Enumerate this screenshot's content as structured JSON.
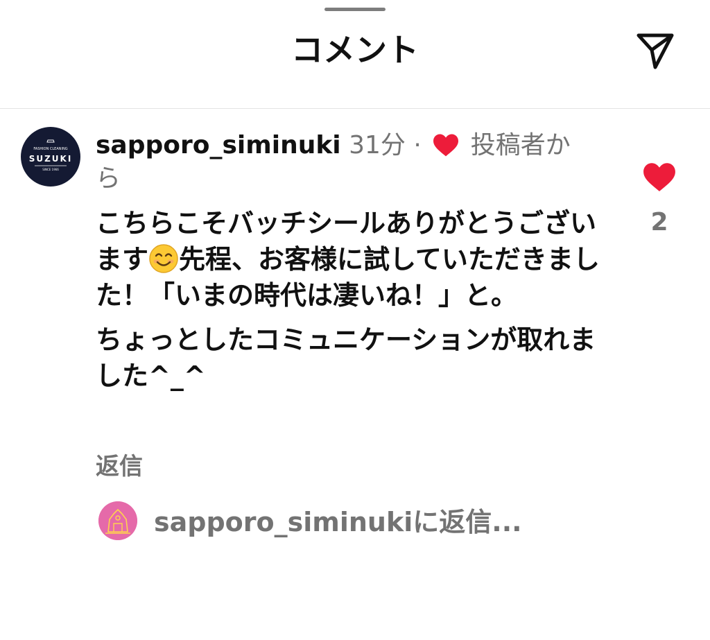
{
  "header": {
    "title": "コメント"
  },
  "comment": {
    "username": "sapporo_siminuki",
    "time": "31分",
    "separator": "·",
    "liked_by_author": "投稿者から",
    "avatar": {
      "brand_small": "FASHION CLEANING",
      "brand_name": "SUZUKI",
      "since": "SINCE 1966"
    },
    "body_line1_before_emoji": "こちらこそバッチシールありがとうございます",
    "body_line1_after_emoji": "先程、お客様に試していただきました！「いまの時代は凄いね！」と。",
    "body_paragraph2": "ちょっとしたコミュニケーションが取れました^_^",
    "reply_label": "返信",
    "like_count": "2"
  },
  "reply_box": {
    "mention": "sapporo_siminuki",
    "suffix": "に返信..."
  },
  "colors": {
    "heart": "#ed1c3a",
    "muted_text": "#737373",
    "avatar_bg": "#141a33",
    "reply_avatar_bg": "#e56aa9"
  },
  "icons": [
    "send-icon",
    "heart-icon",
    "smiling-face-emoji"
  ]
}
